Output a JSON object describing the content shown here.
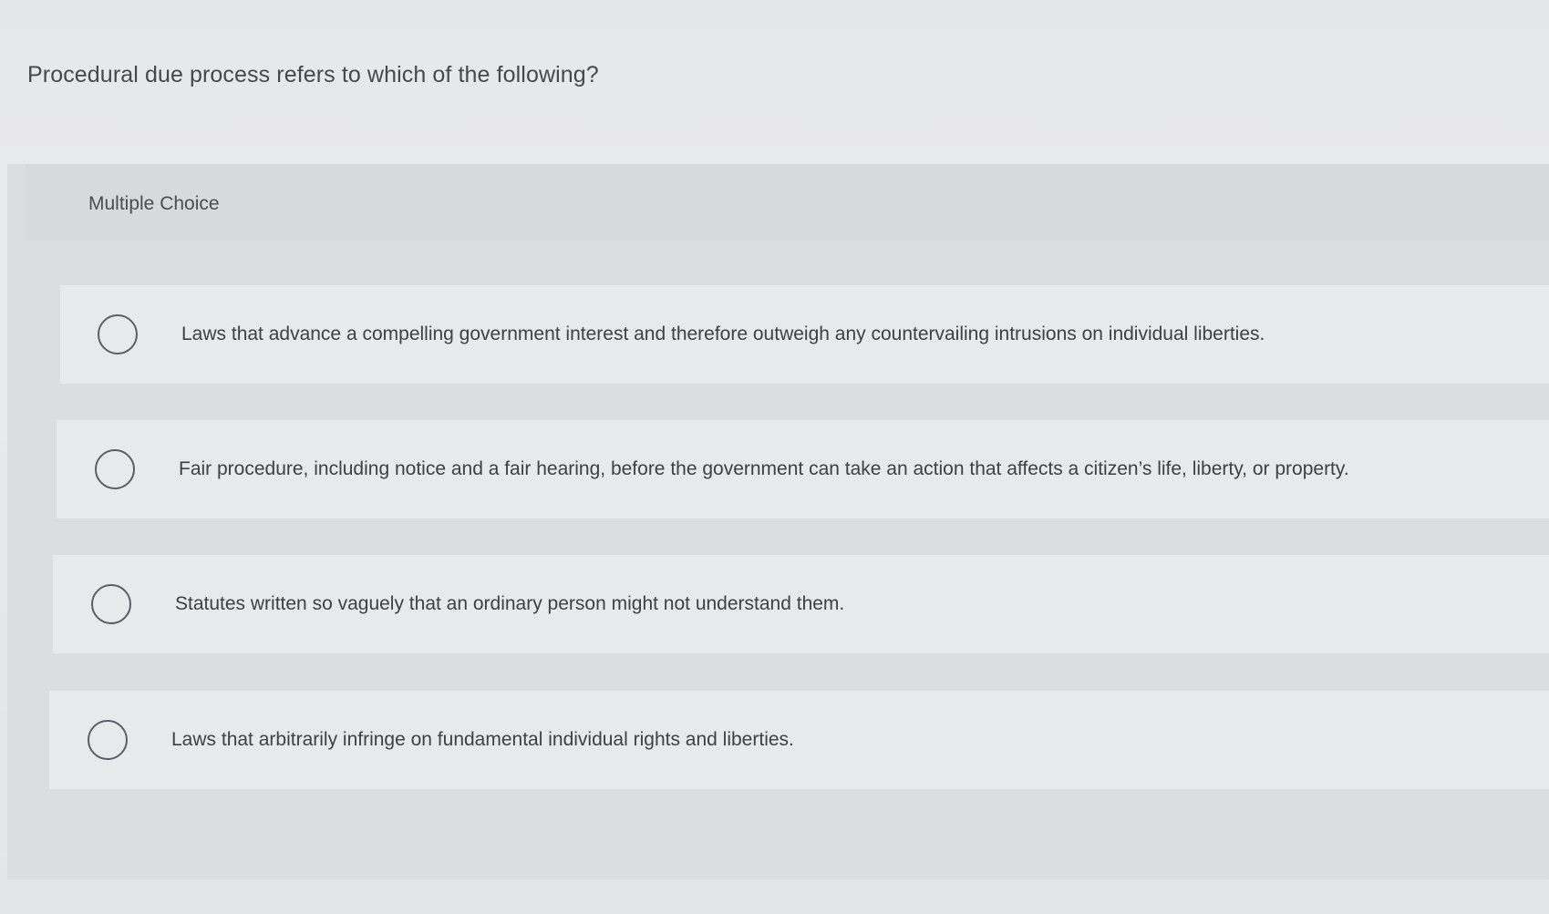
{
  "question": {
    "text": "Procedural due process refers to which of the following?"
  },
  "multiple_choice": {
    "label": "Multiple Choice",
    "options": [
      {
        "text": "Laws that advance a compelling government interest and therefore outweigh any countervailing intrusions on individual liberties."
      },
      {
        "text": "Fair procedure, including notice and a fair hearing, before the government can take an action that affects a citizen’s life, liberty, or property."
      },
      {
        "text": "Statutes written so vaguely that an ordinary person might not understand them."
      },
      {
        "text": "Laws that arbitrarily infringe on fundamental individual rights and liberties."
      }
    ]
  },
  "colors": {
    "background": "#e6e7e9",
    "panel": "#dcdde0",
    "option_row": "#e8e9eb",
    "radio_border": "#5b5e63",
    "text": "#3d4045"
  }
}
